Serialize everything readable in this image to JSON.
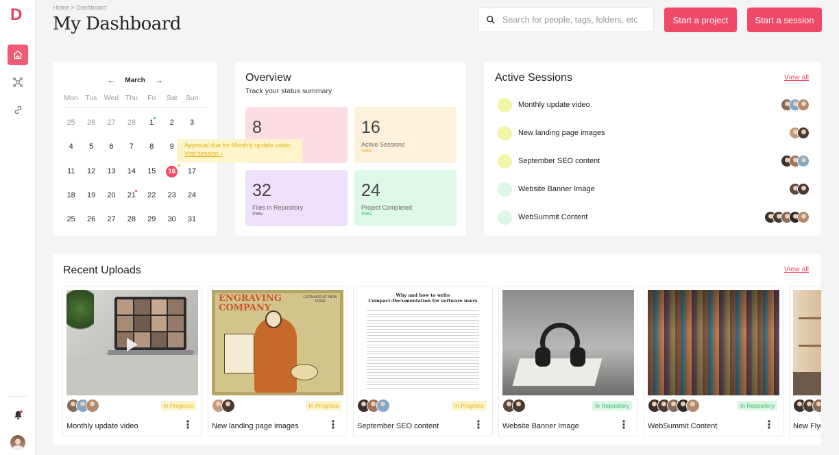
{
  "sidebar": {
    "logo": "D",
    "items": [
      {
        "icon": "home-icon",
        "active": true
      },
      {
        "icon": "network-icon",
        "active": false
      },
      {
        "icon": "link-icon",
        "active": false
      }
    ],
    "bottom": [
      {
        "icon": "bell-icon",
        "has_notification": true
      },
      {
        "icon": "user-avatar",
        "has_notification": false
      }
    ]
  },
  "header": {
    "breadcrumb": "Home > Dashboard",
    "title": "My Dashboard",
    "search_placeholder": "Search for people, tags, folders, etc",
    "start_project": "Start a project",
    "start_session": "Start a session"
  },
  "calendar": {
    "month": "March",
    "days_of_week": [
      "Mon",
      "Tus",
      "Wed",
      "Thu",
      "Fri",
      "Sat",
      "Sun"
    ],
    "weeks": [
      [
        "25",
        "26",
        "27",
        "28",
        "1",
        "2",
        "3"
      ],
      [
        "4",
        "5",
        "6",
        "7",
        "8",
        "9",
        "10"
      ],
      [
        "11",
        "12",
        "13",
        "14",
        "15",
        "16",
        "17"
      ],
      [
        "18",
        "19",
        "20",
        "21",
        "22",
        "23",
        "24"
      ],
      [
        "25",
        "26",
        "27",
        "28",
        "29",
        "30",
        "31"
      ]
    ],
    "today": "16",
    "tooltip": {
      "text": "Approval due for Monthly update video.",
      "link": "Visit session"
    }
  },
  "overview": {
    "title": "Overview",
    "subtitle": "Track your status summary",
    "stats": [
      {
        "value": "8",
        "label": "",
        "view": "",
        "color": "#fddde4",
        "view_color": "#888"
      },
      {
        "value": "16",
        "label": "Active Sessions",
        "view": "View",
        "color": "#fdf1dc",
        "view_color": "#f0a93a"
      },
      {
        "value": "32",
        "label": "Files in Repository",
        "view": "View",
        "color": "#efe0fc",
        "view_color": "#555"
      },
      {
        "value": "24",
        "label": "Project Completed",
        "view": "View",
        "color": "#ddf8e6",
        "view_color": "#2dbd63"
      }
    ]
  },
  "active_sessions": {
    "title": "Active Sessions",
    "view_all": "View all",
    "items": [
      {
        "name": "Monthly update video",
        "color": "#f2f5a5",
        "avatars": 3
      },
      {
        "name": "New landing page images",
        "color": "#f2f5a5",
        "avatars": 2
      },
      {
        "name": "September SEO content",
        "color": "#f2f5a5",
        "avatars": 3
      },
      {
        "name": "Website Banner Image",
        "color": "#dcf7e5",
        "avatars": 2
      },
      {
        "name": "WebSummit Content",
        "color": "#dcf7e5",
        "avatars": 5
      }
    ]
  },
  "recent_uploads": {
    "title": "Recent Uploads",
    "view_all": "View all",
    "items": [
      {
        "name": "Monthly update video",
        "status": "In Progress",
        "status_type": "progress",
        "avatars": 3
      },
      {
        "name": "New landing page images",
        "status": "In Progress",
        "status_type": "progress",
        "avatars": 2
      },
      {
        "name": "September SEO content",
        "status": "In Progress",
        "status_type": "progress",
        "avatars": 3
      },
      {
        "name": "Website Banner Image",
        "status": "In Repository",
        "status_type": "repo",
        "avatars": 2
      },
      {
        "name": "WebSummit Content",
        "status": "In Repository",
        "status_type": "repo",
        "avatars": 5
      },
      {
        "name": "New Flye",
        "status": "",
        "status_type": "",
        "avatars": 3
      }
    ],
    "poster_text": {
      "title": "ENGRAVING",
      "subtitle": "COMPANY",
      "corner": "LEONARD ST NEW YORK"
    },
    "paper": {
      "title": "Why and how to write",
      "subtitle": "Compact-Documentation for software users"
    }
  },
  "colors": {
    "accent": "#ef4967",
    "progress_badge_bg": "#fdf3c8",
    "progress_badge_text": "#e6b520",
    "repo_badge_bg": "#ddf5e4",
    "repo_badge_text": "#36b768"
  }
}
